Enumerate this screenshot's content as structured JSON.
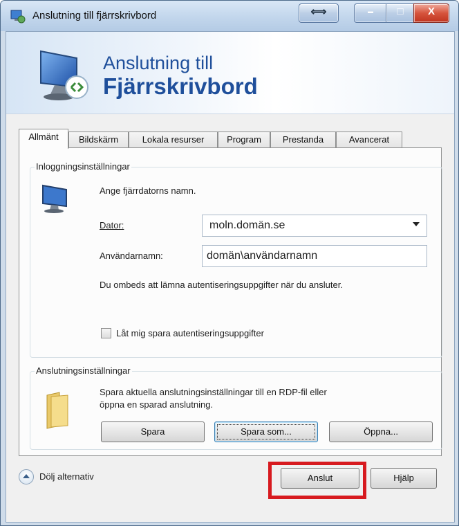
{
  "window": {
    "title": "Anslutning till fjärrskrivbord",
    "controls": {
      "resize": "⟺",
      "minimize": "▬",
      "maximize": "□",
      "close": "X"
    }
  },
  "banner": {
    "line1": "Anslutning till",
    "line2": "Fjärrskrivbord"
  },
  "tabs": [
    "Allmänt",
    "Bildskärm",
    "Lokala resurser",
    "Program",
    "Prestanda",
    "Avancerat"
  ],
  "active_tab": "Allmänt",
  "login_group": {
    "label": "Inloggningsinställningar",
    "instruction": "Ange fjärrdatorns namn.",
    "computer_label": "Dator:",
    "computer_value": "moln.domän.se",
    "username_label": "Användarnamn:",
    "username_value": "domän\\användarnamn",
    "credentials_note": "Du ombeds att lämna autentiseringsuppgifter när du ansluter.",
    "save_credentials_label": "Låt mig spara autentiseringsuppgifter",
    "save_credentials_checked": false
  },
  "connection_group": {
    "label": "Anslutningsinställningar",
    "description_line1": "Spara aktuella anslutningsinställningar till en RDP-fil eller",
    "description_line2": "öppna en sparad anslutning.",
    "save_button": "Spara",
    "save_as_button": "Spara som...",
    "open_button": "Öppna..."
  },
  "footer": {
    "hide_options_label": "Dölj alternativ",
    "connect_button": "Anslut",
    "help_button": "Hjälp"
  },
  "colors": {
    "highlight": "#d71a1f",
    "banner_text": "#1f4f9b"
  },
  "icons": [
    "remote-desktop-icon",
    "monitor-icon",
    "folder-icon",
    "chevron-up-icon",
    "dropdown-arrow-icon"
  ]
}
